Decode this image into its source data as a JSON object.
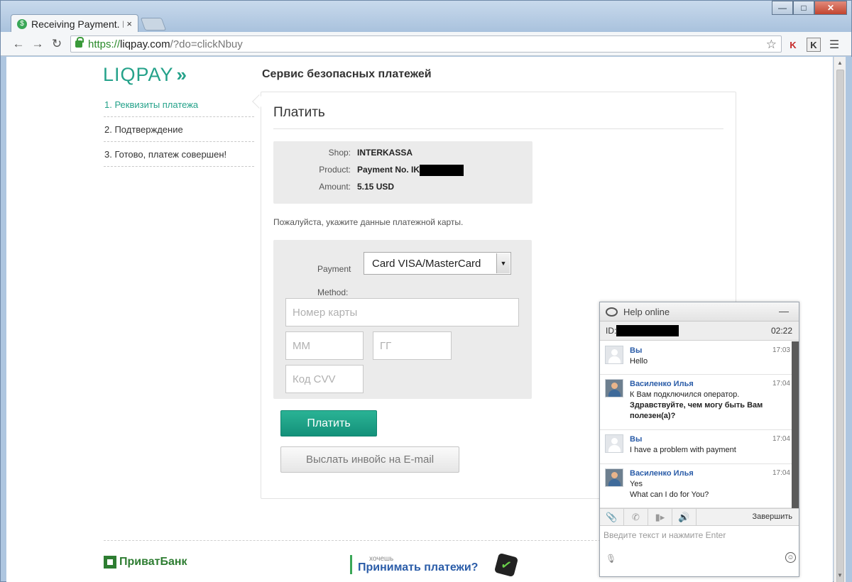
{
  "browser": {
    "tab_title": "Receiving Payment. P",
    "tab_close": "×",
    "url_scheme": "https://",
    "url_host": "liqpay.com",
    "url_path": "/?do=clickNbuy",
    "win_minimize": "—",
    "win_maximize": "□",
    "win_close": "✕",
    "icons": [
      "back-icon",
      "forward-icon",
      "reload-icon",
      "lock-icon",
      "star-icon",
      "kaspersky-icon",
      "k-extension-icon",
      "menu-icon"
    ]
  },
  "page": {
    "logo": "LIQPAY",
    "logo_chevrons": "»",
    "service_title": "Сервис безопасных платежей",
    "steps": [
      {
        "label": "1. Реквизиты платежа"
      },
      {
        "label": "2. Подтверждение"
      },
      {
        "label": "3. Готово, платеж совершен!"
      }
    ],
    "panel_title": "Платить",
    "summary": {
      "shop_label": "Shop:",
      "shop_value": "INTERKASSA",
      "product_label": "Product:",
      "product_value": "Payment No. IK",
      "amount_label": "Amount:",
      "amount_value": "5.15 USD"
    },
    "card_prompt": "Пожалуйста, укажите данные платежной карты.",
    "form": {
      "payment_method_label": "Payment Method:",
      "payment_method_value": "Card VISA/MasterCard",
      "card_number_placeholder": "Номер карты",
      "month_placeholder": "ММ",
      "year_placeholder": "ГГ",
      "cvv_placeholder": "Код CVV"
    },
    "pay_button": "Платить",
    "invoice_button": "Выслать инвойс на E-mail",
    "footer": {
      "bank": "ПриватБанк",
      "accept_small": "хочешь",
      "accept_big": "Принимать платежи?",
      "badge": "✓"
    }
  },
  "chat": {
    "title": "Help online",
    "minimize": "—",
    "id_label": "ID:",
    "session_time": "02:22",
    "messages": [
      {
        "who": "Вы",
        "time": "17:03",
        "line1": "Hello",
        "line2": ""
      },
      {
        "who": "Василенко Илья",
        "time": "17:04",
        "line1": "К Вам подключился оператор.",
        "line2": "Здравствуйте, чем могу быть Вам полезен(а)?"
      },
      {
        "who": "Вы",
        "time": "17:04",
        "line1": "I have a problem with payment",
        "line2": ""
      },
      {
        "who": "Василенко Илья",
        "time": "17:04",
        "line1": "Yes",
        "line2": "What can I do for You?"
      }
    ],
    "end_chat": "Завершить",
    "input_placeholder": "Введите текст и нажмите Enter",
    "tool_icons": [
      "paperclip-icon",
      "phone-icon",
      "video-icon",
      "speaker-icon"
    ]
  }
}
